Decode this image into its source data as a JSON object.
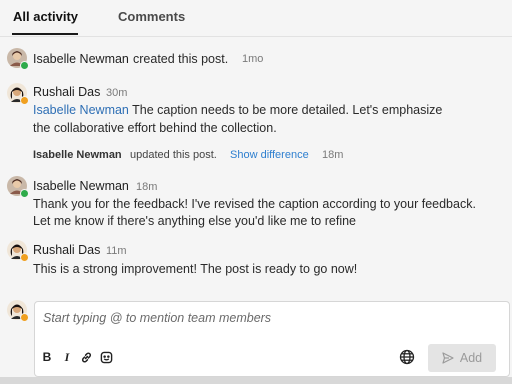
{
  "tabs": [
    {
      "label": "All activity"
    },
    {
      "label": "Comments"
    }
  ],
  "activity": [
    {
      "name": "Isabelle Newman",
      "action": "created this post.",
      "time": "1mo"
    },
    {
      "name": "Rushali Das",
      "time": "30m",
      "mention": "Isabelle Newman",
      "line1": " The caption needs to be more detailed. Let's emphasize",
      "line2": "the collaborative effort behind the collection."
    },
    {
      "name": "Isabelle Newman",
      "action": "updated this post.",
      "link": "Show difference",
      "time": "18m"
    },
    {
      "name": "Isabelle Newman",
      "time": "18m",
      "line1": "Thank you for the feedback! I've revised the caption according to your feedback.",
      "line2": "Let me know if there's anything else you'd like me to refine"
    },
    {
      "name": "Rushali Das",
      "time": "11m",
      "line1": "This is a strong improvement! The post is ready to go now!"
    }
  ],
  "composer": {
    "placeholder": "Start typing @ to mention team members",
    "bold": "B",
    "italic": "I",
    "add_label": "Add"
  },
  "colors": {
    "accent": "#2e7fcf",
    "online": "#2eaa4a",
    "away": "#f0a020"
  }
}
